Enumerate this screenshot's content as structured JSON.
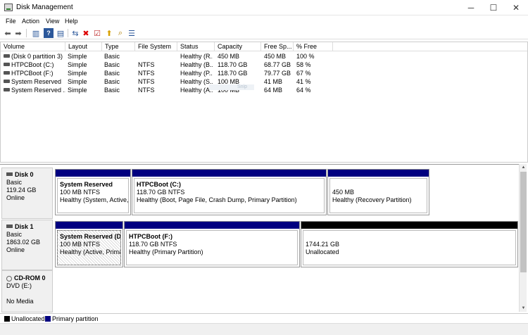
{
  "window": {
    "title": "Disk Management",
    "minimize": "─",
    "maximize": "☐",
    "close": "✕"
  },
  "menu": [
    "File",
    "Action",
    "View",
    "Help"
  ],
  "toolbar": {
    "icons": [
      "back-icon",
      "forward-icon",
      "console-tree-icon",
      "help-icon",
      "properties-icon",
      "connect-icon",
      "delete-icon",
      "check-icon",
      "up-icon",
      "search-icon",
      "list-icon"
    ],
    "glyphs": [
      "⬅",
      "➡",
      "▥",
      "?",
      "▤",
      "⇆",
      "✖",
      "☑",
      "⬆",
      "⌕",
      "☰"
    ]
  },
  "volume_list": {
    "columns": [
      "Volume",
      "Layout",
      "Type",
      "File System",
      "Status",
      "Capacity",
      "Free Sp...",
      "% Free"
    ],
    "rows": [
      [
        "(Disk 0 partition 3)",
        "Simple",
        "Basic",
        "",
        "Healthy (R...",
        "450 MB",
        "450 MB",
        "100 %"
      ],
      [
        "HTPCBoot (C:)",
        "Simple",
        "Basic",
        "NTFS",
        "Healthy (B...",
        "118.70 GB",
        "68.77 GB",
        "58 %"
      ],
      [
        "HTPCBoot (F:)",
        "Simple",
        "Basic",
        "NTFS",
        "Healthy (P...",
        "118.70 GB",
        "79.77 GB",
        "67 %"
      ],
      [
        "System Reserved",
        "Simple",
        "Basic",
        "NTFS",
        "Healthy (S...",
        "100 MB",
        "41 MB",
        "41 %"
      ],
      [
        "System Reserved ...",
        "Simple",
        "Basic",
        "NTFS",
        "Healthy (A...",
        "100 MB",
        "64 MB",
        "64 %"
      ]
    ],
    "watermark": "Snip"
  },
  "disks": [
    {
      "name": "Disk 0",
      "type": "Basic",
      "size": "119.24 GB",
      "state": "Online",
      "partitions": [
        {
          "title": "System Reserved",
          "size": "100 MB NTFS",
          "status": "Healthy (System, Active, Pr"
        },
        {
          "title": "HTPCBoot  (C:)",
          "size": "118.70 GB NTFS",
          "status": "Healthy (Boot, Page File, Crash Dump, Primary Partition)"
        },
        {
          "title": "",
          "size": "450 MB",
          "status": "Healthy (Recovery Partition)"
        }
      ]
    },
    {
      "name": "Disk 1",
      "type": "Basic",
      "size": "1863.02 GB",
      "state": "Online",
      "partitions": [
        {
          "title": "System Reserved  (D:)",
          "size": "100 MB NTFS",
          "status": "Healthy (Active, Primary"
        },
        {
          "title": "HTPCBoot  (F:)",
          "size": "118.70 GB NTFS",
          "status": "Healthy (Primary Partition)"
        },
        {
          "title": "",
          "size": "1744.21 GB",
          "status": "Unallocated"
        }
      ]
    },
    {
      "name": "CD-ROM 0",
      "type": "DVD (E:)",
      "size": "",
      "state": "No Media",
      "partitions": []
    }
  ],
  "legend": {
    "unallocated": {
      "label": "Unallocated",
      "color": "#000000"
    },
    "primary": {
      "label": "Primary partition",
      "color": "#010080"
    }
  }
}
